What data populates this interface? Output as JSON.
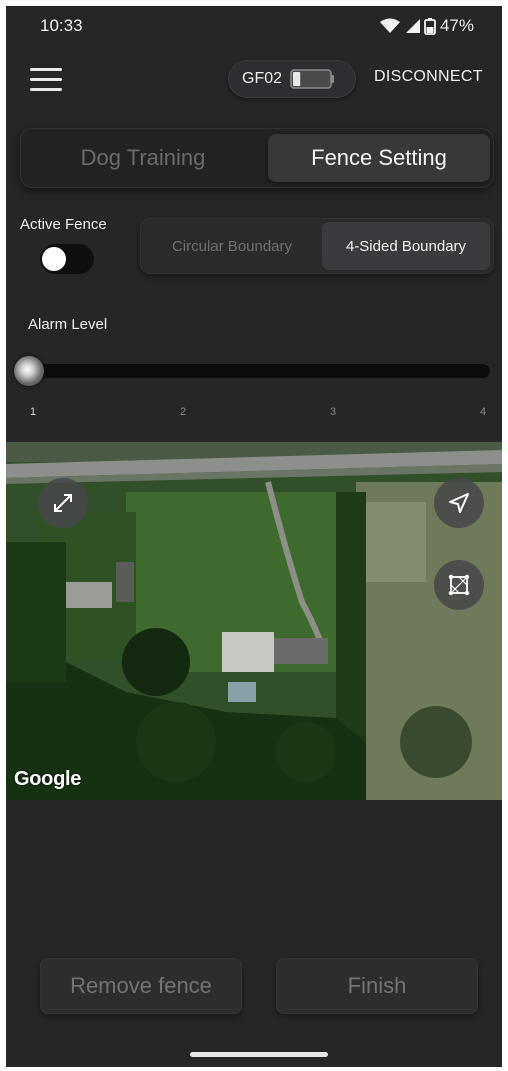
{
  "status_bar": {
    "time": "10:33",
    "battery_percent": "47%"
  },
  "header": {
    "device_name": "GF02",
    "device_battery_level": 0.2,
    "disconnect_label": "DISCONNECT"
  },
  "mode_tabs": {
    "tabs": [
      {
        "label": "Dog Training",
        "selected": false
      },
      {
        "label": "Fence Setting",
        "selected": true
      }
    ]
  },
  "fence": {
    "active_label": "Active Fence",
    "active": false,
    "boundary_options": [
      {
        "label": "Circular Boundary",
        "selected": false
      },
      {
        "label": "4-Sided Boundary",
        "selected": true
      }
    ]
  },
  "alarm": {
    "label": "Alarm Level",
    "value": 1,
    "ticks": [
      "1",
      "2",
      "3",
      "4"
    ]
  },
  "map": {
    "attribution": "Google",
    "buttons": [
      "expand-icon",
      "navigate-icon",
      "polygon-icon"
    ]
  },
  "actions": {
    "remove_label": "Remove fence",
    "finish_label": "Finish"
  },
  "colors": {
    "background": "#262629",
    "selected_tab": "#38383b",
    "text": "#f0f0f0",
    "disabled_text": "#747477"
  }
}
